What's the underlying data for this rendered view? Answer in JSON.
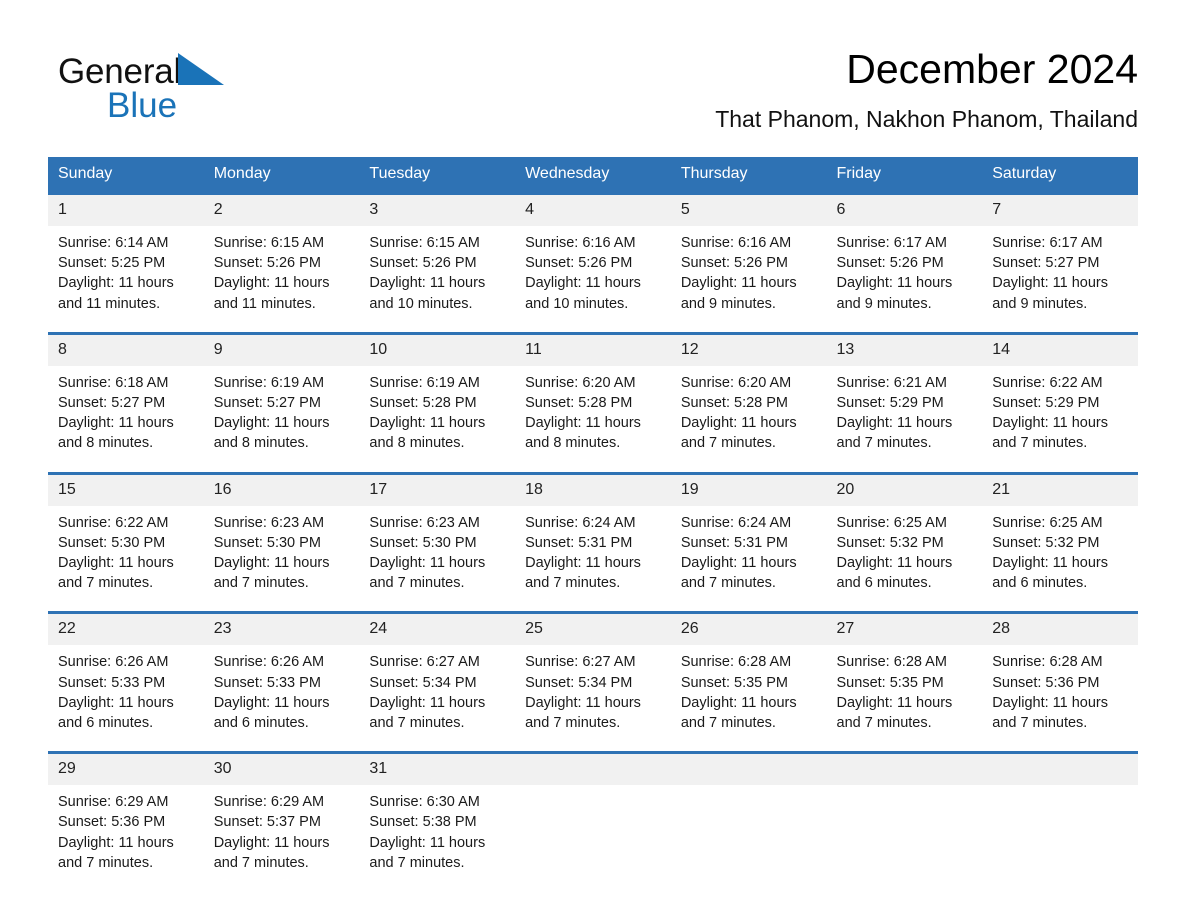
{
  "brand": {
    "name_part1": "General",
    "name_part2": "Blue",
    "triangle_color": "#1a73b8"
  },
  "header": {
    "title": "December 2024",
    "subtitle": "That Phanom, Nakhon Phanom, Thailand",
    "accent_color": "#2e72b4",
    "daynum_bg": "#f1f1f1"
  },
  "weekday_headers": [
    "Sunday",
    "Monday",
    "Tuesday",
    "Wednesday",
    "Thursday",
    "Friday",
    "Saturday"
  ],
  "weeks": [
    [
      {
        "day": "1",
        "sunrise": "Sunrise: 6:14 AM",
        "sunset": "Sunset: 5:25 PM",
        "daylight_line1": "Daylight: 11 hours",
        "daylight_line2": "and 11 minutes."
      },
      {
        "day": "2",
        "sunrise": "Sunrise: 6:15 AM",
        "sunset": "Sunset: 5:26 PM",
        "daylight_line1": "Daylight: 11 hours",
        "daylight_line2": "and 11 minutes."
      },
      {
        "day": "3",
        "sunrise": "Sunrise: 6:15 AM",
        "sunset": "Sunset: 5:26 PM",
        "daylight_line1": "Daylight: 11 hours",
        "daylight_line2": "and 10 minutes."
      },
      {
        "day": "4",
        "sunrise": "Sunrise: 6:16 AM",
        "sunset": "Sunset: 5:26 PM",
        "daylight_line1": "Daylight: 11 hours",
        "daylight_line2": "and 10 minutes."
      },
      {
        "day": "5",
        "sunrise": "Sunrise: 6:16 AM",
        "sunset": "Sunset: 5:26 PM",
        "daylight_line1": "Daylight: 11 hours",
        "daylight_line2": "and 9 minutes."
      },
      {
        "day": "6",
        "sunrise": "Sunrise: 6:17 AM",
        "sunset": "Sunset: 5:26 PM",
        "daylight_line1": "Daylight: 11 hours",
        "daylight_line2": "and 9 minutes."
      },
      {
        "day": "7",
        "sunrise": "Sunrise: 6:17 AM",
        "sunset": "Sunset: 5:27 PM",
        "daylight_line1": "Daylight: 11 hours",
        "daylight_line2": "and 9 minutes."
      }
    ],
    [
      {
        "day": "8",
        "sunrise": "Sunrise: 6:18 AM",
        "sunset": "Sunset: 5:27 PM",
        "daylight_line1": "Daylight: 11 hours",
        "daylight_line2": "and 8 minutes."
      },
      {
        "day": "9",
        "sunrise": "Sunrise: 6:19 AM",
        "sunset": "Sunset: 5:27 PM",
        "daylight_line1": "Daylight: 11 hours",
        "daylight_line2": "and 8 minutes."
      },
      {
        "day": "10",
        "sunrise": "Sunrise: 6:19 AM",
        "sunset": "Sunset: 5:28 PM",
        "daylight_line1": "Daylight: 11 hours",
        "daylight_line2": "and 8 minutes."
      },
      {
        "day": "11",
        "sunrise": "Sunrise: 6:20 AM",
        "sunset": "Sunset: 5:28 PM",
        "daylight_line1": "Daylight: 11 hours",
        "daylight_line2": "and 8 minutes."
      },
      {
        "day": "12",
        "sunrise": "Sunrise: 6:20 AM",
        "sunset": "Sunset: 5:28 PM",
        "daylight_line1": "Daylight: 11 hours",
        "daylight_line2": "and 7 minutes."
      },
      {
        "day": "13",
        "sunrise": "Sunrise: 6:21 AM",
        "sunset": "Sunset: 5:29 PM",
        "daylight_line1": "Daylight: 11 hours",
        "daylight_line2": "and 7 minutes."
      },
      {
        "day": "14",
        "sunrise": "Sunrise: 6:22 AM",
        "sunset": "Sunset: 5:29 PM",
        "daylight_line1": "Daylight: 11 hours",
        "daylight_line2": "and 7 minutes."
      }
    ],
    [
      {
        "day": "15",
        "sunrise": "Sunrise: 6:22 AM",
        "sunset": "Sunset: 5:30 PM",
        "daylight_line1": "Daylight: 11 hours",
        "daylight_line2": "and 7 minutes."
      },
      {
        "day": "16",
        "sunrise": "Sunrise: 6:23 AM",
        "sunset": "Sunset: 5:30 PM",
        "daylight_line1": "Daylight: 11 hours",
        "daylight_line2": "and 7 minutes."
      },
      {
        "day": "17",
        "sunrise": "Sunrise: 6:23 AM",
        "sunset": "Sunset: 5:30 PM",
        "daylight_line1": "Daylight: 11 hours",
        "daylight_line2": "and 7 minutes."
      },
      {
        "day": "18",
        "sunrise": "Sunrise: 6:24 AM",
        "sunset": "Sunset: 5:31 PM",
        "daylight_line1": "Daylight: 11 hours",
        "daylight_line2": "and 7 minutes."
      },
      {
        "day": "19",
        "sunrise": "Sunrise: 6:24 AM",
        "sunset": "Sunset: 5:31 PM",
        "daylight_line1": "Daylight: 11 hours",
        "daylight_line2": "and 7 minutes."
      },
      {
        "day": "20",
        "sunrise": "Sunrise: 6:25 AM",
        "sunset": "Sunset: 5:32 PM",
        "daylight_line1": "Daylight: 11 hours",
        "daylight_line2": "and 6 minutes."
      },
      {
        "day": "21",
        "sunrise": "Sunrise: 6:25 AM",
        "sunset": "Sunset: 5:32 PM",
        "daylight_line1": "Daylight: 11 hours",
        "daylight_line2": "and 6 minutes."
      }
    ],
    [
      {
        "day": "22",
        "sunrise": "Sunrise: 6:26 AM",
        "sunset": "Sunset: 5:33 PM",
        "daylight_line1": "Daylight: 11 hours",
        "daylight_line2": "and 6 minutes."
      },
      {
        "day": "23",
        "sunrise": "Sunrise: 6:26 AM",
        "sunset": "Sunset: 5:33 PM",
        "daylight_line1": "Daylight: 11 hours",
        "daylight_line2": "and 6 minutes."
      },
      {
        "day": "24",
        "sunrise": "Sunrise: 6:27 AM",
        "sunset": "Sunset: 5:34 PM",
        "daylight_line1": "Daylight: 11 hours",
        "daylight_line2": "and 7 minutes."
      },
      {
        "day": "25",
        "sunrise": "Sunrise: 6:27 AM",
        "sunset": "Sunset: 5:34 PM",
        "daylight_line1": "Daylight: 11 hours",
        "daylight_line2": "and 7 minutes."
      },
      {
        "day": "26",
        "sunrise": "Sunrise: 6:28 AM",
        "sunset": "Sunset: 5:35 PM",
        "daylight_line1": "Daylight: 11 hours",
        "daylight_line2": "and 7 minutes."
      },
      {
        "day": "27",
        "sunrise": "Sunrise: 6:28 AM",
        "sunset": "Sunset: 5:35 PM",
        "daylight_line1": "Daylight: 11 hours",
        "daylight_line2": "and 7 minutes."
      },
      {
        "day": "28",
        "sunrise": "Sunrise: 6:28 AM",
        "sunset": "Sunset: 5:36 PM",
        "daylight_line1": "Daylight: 11 hours",
        "daylight_line2": "and 7 minutes."
      }
    ],
    [
      {
        "day": "29",
        "sunrise": "Sunrise: 6:29 AM",
        "sunset": "Sunset: 5:36 PM",
        "daylight_line1": "Daylight: 11 hours",
        "daylight_line2": "and 7 minutes."
      },
      {
        "day": "30",
        "sunrise": "Sunrise: 6:29 AM",
        "sunset": "Sunset: 5:37 PM",
        "daylight_line1": "Daylight: 11 hours",
        "daylight_line2": "and 7 minutes."
      },
      {
        "day": "31",
        "sunrise": "Sunrise: 6:30 AM",
        "sunset": "Sunset: 5:38 PM",
        "daylight_line1": "Daylight: 11 hours",
        "daylight_line2": "and 7 minutes."
      },
      {
        "day": "",
        "sunrise": "",
        "sunset": "",
        "daylight_line1": "",
        "daylight_line2": ""
      },
      {
        "day": "",
        "sunrise": "",
        "sunset": "",
        "daylight_line1": "",
        "daylight_line2": ""
      },
      {
        "day": "",
        "sunrise": "",
        "sunset": "",
        "daylight_line1": "",
        "daylight_line2": ""
      },
      {
        "day": "",
        "sunrise": "",
        "sunset": "",
        "daylight_line1": "",
        "daylight_line2": ""
      }
    ]
  ]
}
